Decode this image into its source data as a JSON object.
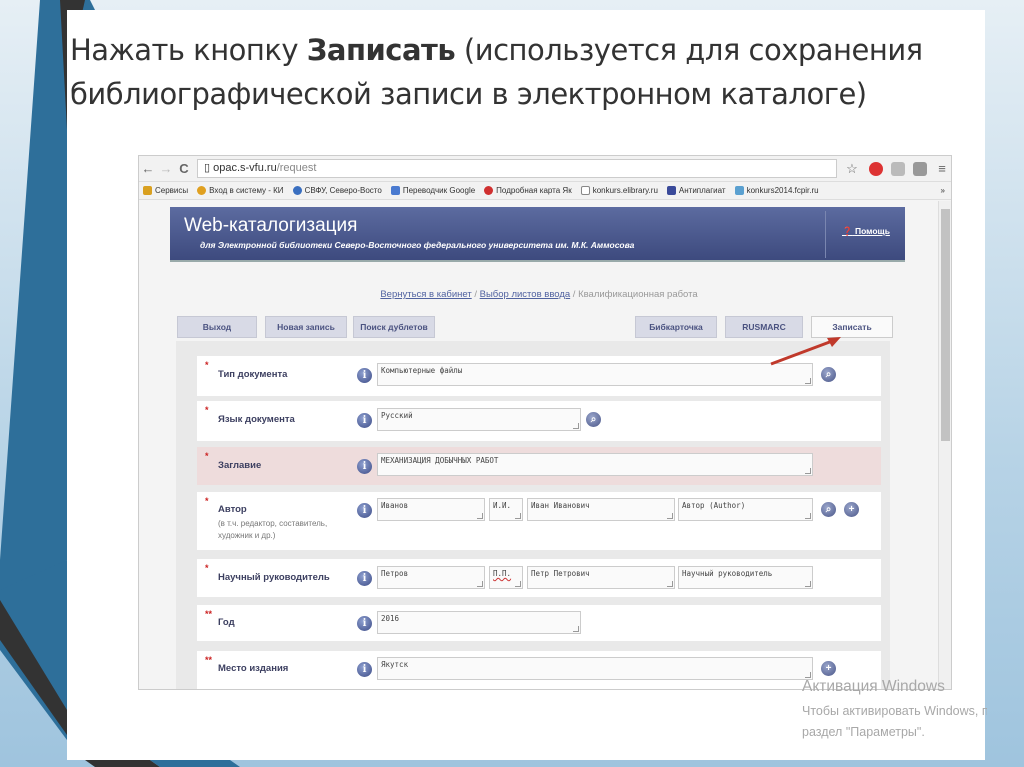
{
  "slide": {
    "title_pre": "Нажать кнопку ",
    "title_bold": "Записать",
    "title_post": " (используется для сохранения библиографической записи в электронном каталоге)"
  },
  "browser": {
    "url_host": "opac.s-vfu.ru",
    "url_path": "/request",
    "bookmarks": [
      "Сервисы",
      "Вход в систему - КИ",
      "СВФУ, Северо-Восто",
      "Переводчик Google",
      "Подробная карта Як",
      "konkurs.elibrary.ru",
      "Антиплагиат",
      "konkurs2014.fcpir.ru"
    ],
    "bookmark_colors": [
      "#d9a020",
      "#e0a020",
      "#3a6fc0",
      "#4a7ad0",
      "#d03030",
      "#888888",
      "#3a4a9a",
      "#5aa0d0"
    ]
  },
  "header": {
    "title": "Web-каталогизация",
    "subtitle": "для Электронной библиотеки Северо-Восточного федерального университета им. М.К. Аммосова",
    "help": "Помощь"
  },
  "breadcrumb": {
    "back": "Вернуться в кабинет",
    "select": "Выбор листов ввода",
    "current": "Квалификационная работа"
  },
  "buttons": {
    "exit": "Выход",
    "new": "Новая запись",
    "dupes": "Поиск дублетов",
    "card": "Бибкарточка",
    "rusmarc": "RUSMARC",
    "save": "Записать"
  },
  "form": {
    "doc_type": {
      "label": "Тип документа",
      "value": "Компьютерные файлы"
    },
    "language": {
      "label": "Язык документа",
      "value": "Русский"
    },
    "title": {
      "label": "Заглавие",
      "value": "МЕХАНИЗАЦИЯ ДОБЫЧНЫХ РАБОТ"
    },
    "author": {
      "label": "Автор",
      "note": "(в т.ч. редактор, составитель, художник и др.)",
      "surname": "Иванов",
      "initials": "И.И.",
      "name": "Иван Иванович",
      "role": "Автор (Author)"
    },
    "advisor": {
      "label": "Научный руководитель",
      "surname": "Петров",
      "initials": "П.П.",
      "name": "Петр Петрович",
      "role": "Научный руководитель"
    },
    "year": {
      "label": "Год",
      "value": "2016"
    },
    "place": {
      "label": "Место издания",
      "value": "Якутск"
    },
    "star1": "*",
    "star2": "**"
  },
  "watermark": {
    "title": "Активация Windows",
    "line1": "Чтобы активировать Windows, перейдите в",
    "line2": "раздел \"Параметры\"."
  }
}
